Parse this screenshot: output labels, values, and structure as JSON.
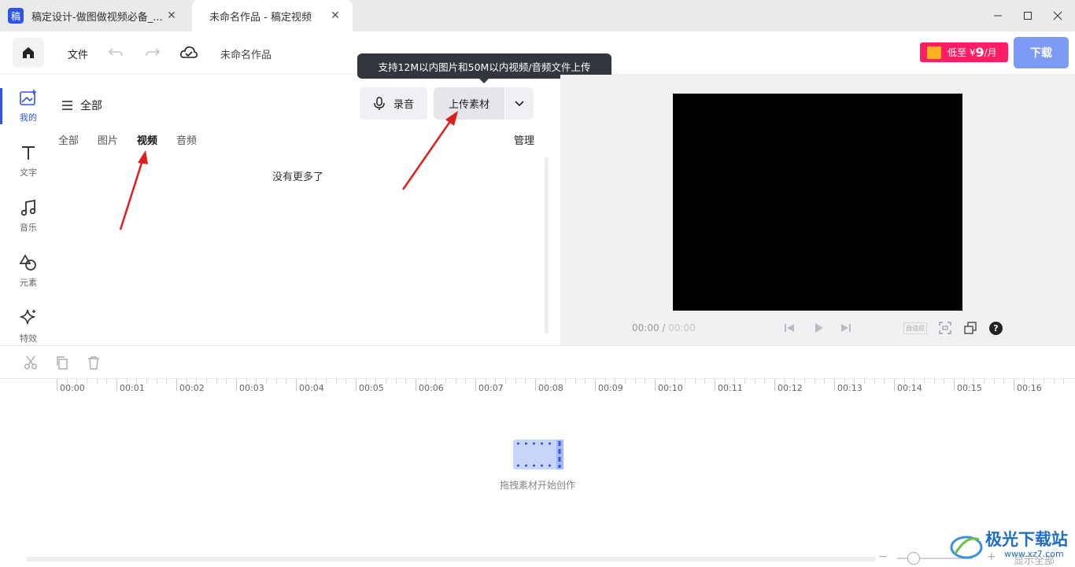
{
  "tabs": [
    {
      "label": "稿定设计-做图做视频必备_..."
    },
    {
      "label": "未命名作品 - 稿定视频"
    }
  ],
  "app_logo_char": "稿",
  "toolbar": {
    "file_label": "文件",
    "project_name": "未命名作品",
    "promo_prefix": "低至 ¥",
    "promo_price": "9",
    "promo_suffix": "/月",
    "download_label": "下载"
  },
  "nav": [
    {
      "label": "我的",
      "icon": "my-upload-icon",
      "active": true
    },
    {
      "label": "文字",
      "icon": "text-icon"
    },
    {
      "label": "音乐",
      "icon": "music-icon"
    },
    {
      "label": "元素",
      "icon": "shapes-icon"
    },
    {
      "label": "特效",
      "icon": "sparkle-icon"
    }
  ],
  "panel": {
    "filter_label": "全部",
    "record_label": "录音",
    "upload_label": "上传素材",
    "tooltip": "支持12M以内图片和50M以内视频/音频文件上传",
    "sub_tabs": [
      "全部",
      "图片",
      "视频",
      "音频"
    ],
    "active_sub_tab": "视频",
    "manage_label": "管理",
    "empty_text": "没有更多了"
  },
  "player": {
    "current_time": "00:00",
    "separator": " / ",
    "total_time": "00:00",
    "auto_fit_label": "自适应",
    "help_label": "?"
  },
  "timeline": {
    "ticks": [
      "00:00",
      "00:01",
      "00:02",
      "00:03",
      "00:04",
      "00:05",
      "00:06",
      "00:07",
      "00:08",
      "00:09",
      "00:10",
      "00:11",
      "00:12",
      "00:13",
      "00:14",
      "00:15",
      "00:16"
    ],
    "empty_hint": "拖拽素材开始创作",
    "show_all_label": "显示全部"
  },
  "watermark": {
    "text": "极光下载站",
    "url_text": "www.xz7.com"
  },
  "colors": {
    "accent": "#2f54eb",
    "promo": "#ff1e64",
    "download": "#7d9bf5",
    "annotation_arrow": "#e01e1e"
  }
}
